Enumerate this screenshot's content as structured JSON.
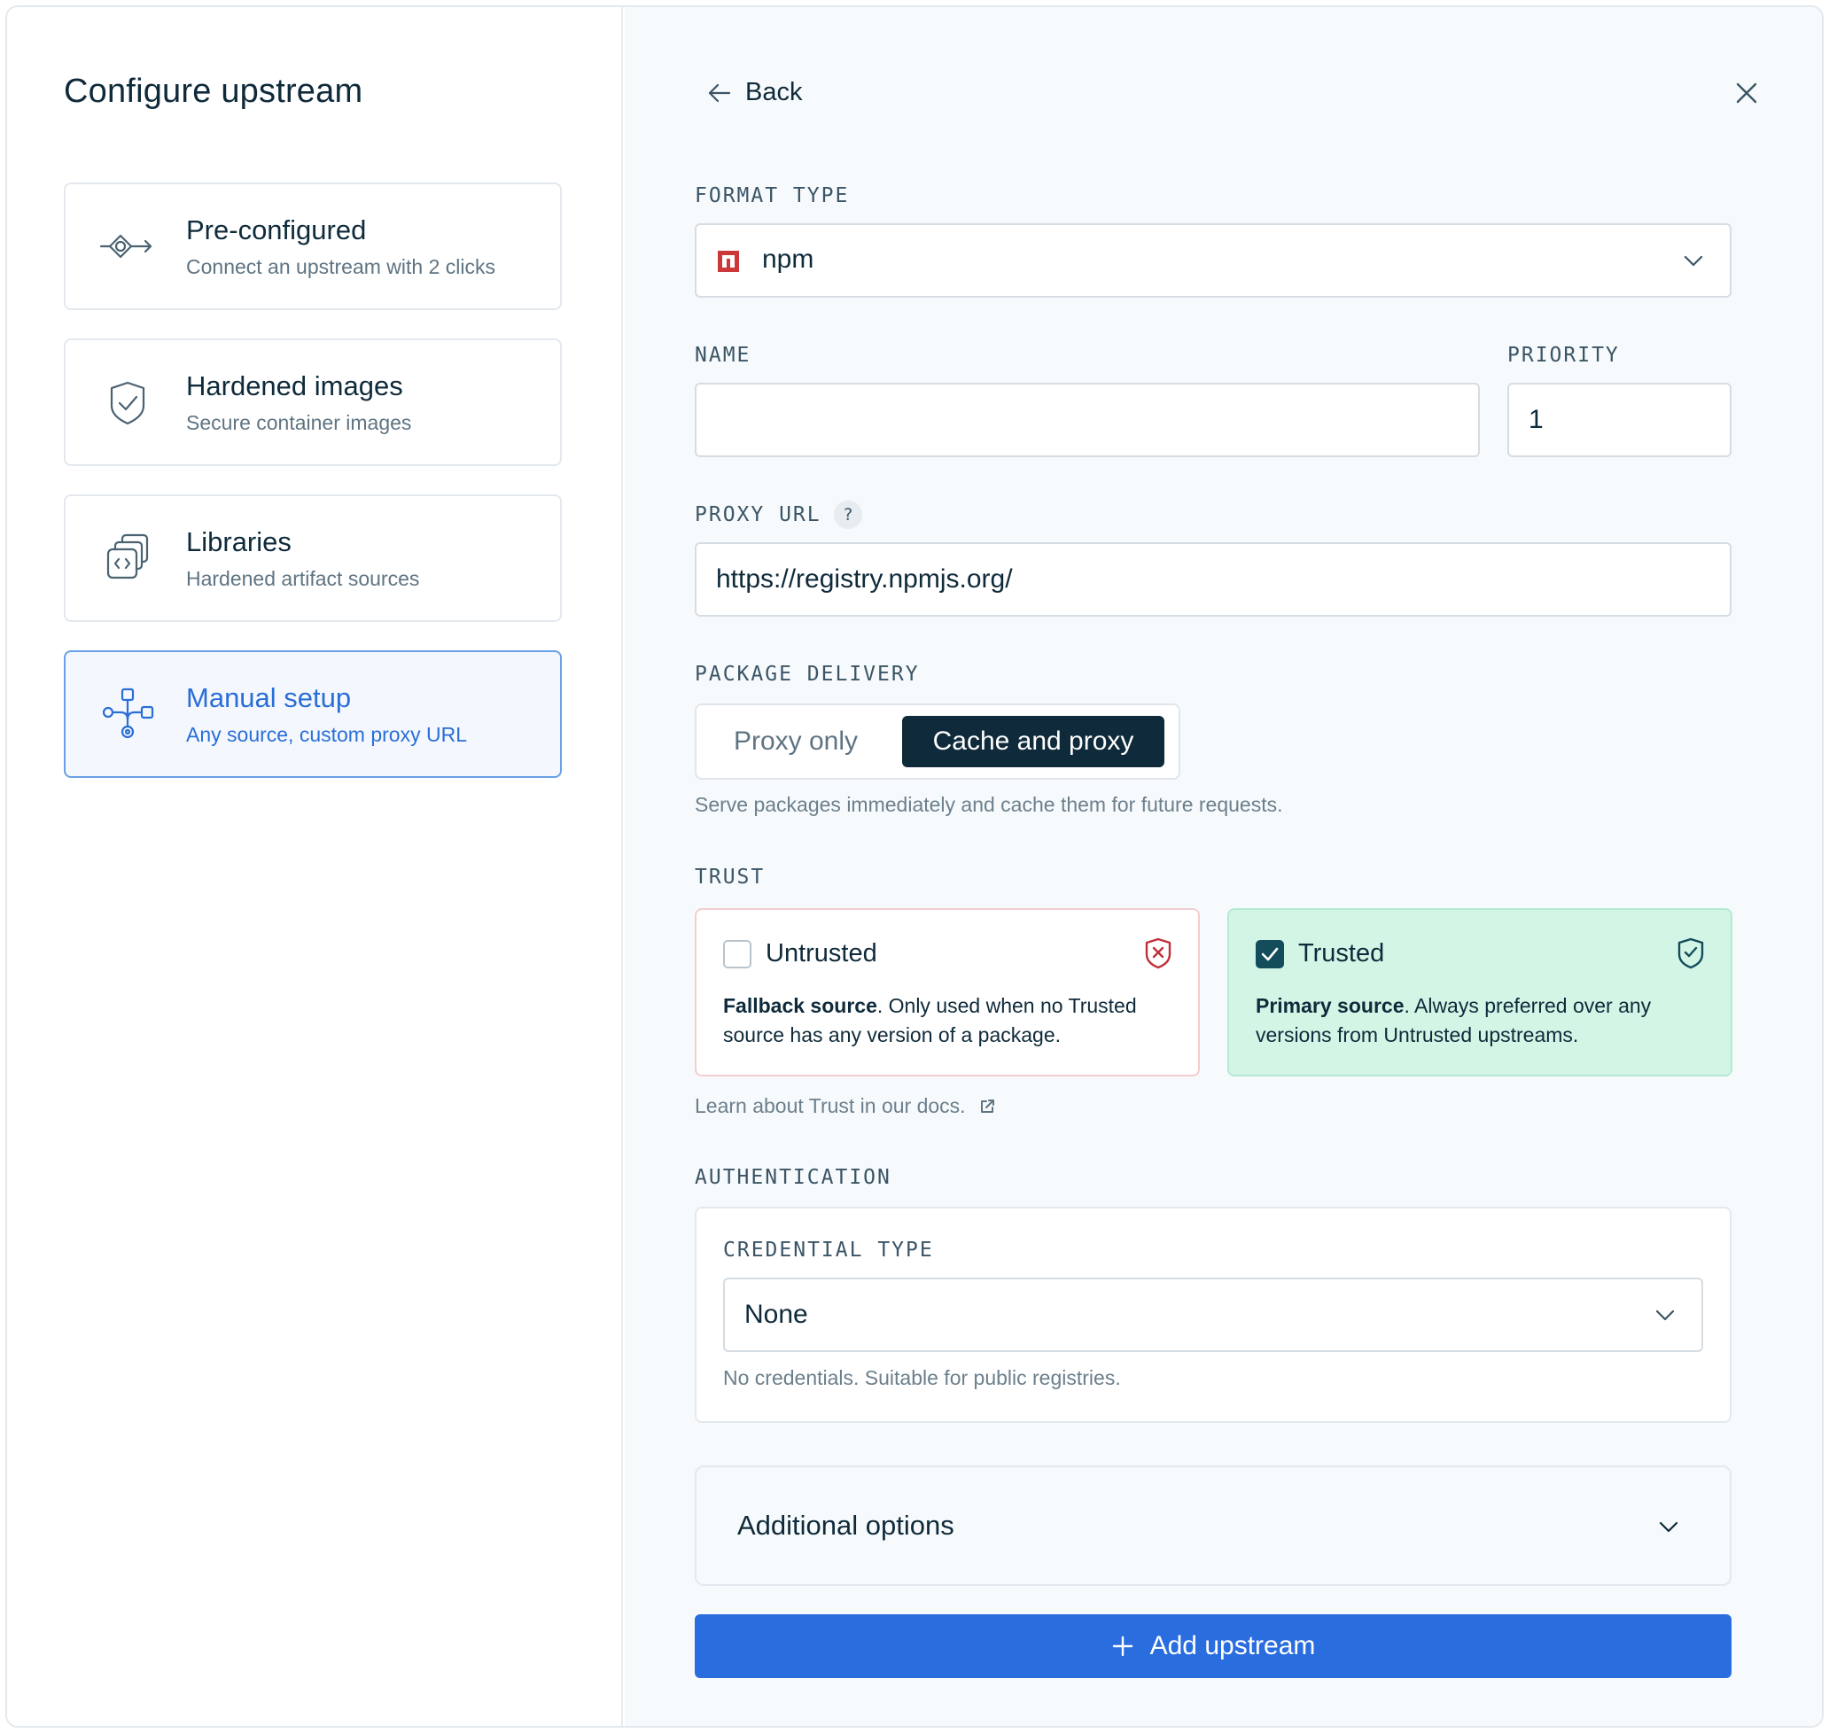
{
  "sidebar": {
    "title": "Configure upstream",
    "options": [
      {
        "title": "Pre-configured",
        "subtitle": "Connect an upstream with 2 clicks",
        "icon": "connector-icon"
      },
      {
        "title": "Hardened images",
        "subtitle": "Secure container images",
        "icon": "shield-check-icon"
      },
      {
        "title": "Libraries",
        "subtitle": "Hardened artifact sources",
        "icon": "code-stack-icon"
      },
      {
        "title": "Manual setup",
        "subtitle": "Any source, custom proxy URL",
        "icon": "network-nodes-icon",
        "selected": true
      }
    ]
  },
  "header": {
    "back_label": "Back"
  },
  "format": {
    "label": "FORMAT TYPE",
    "value": "npm",
    "icon": "npm-logo-icon"
  },
  "name": {
    "label": "NAME",
    "value": ""
  },
  "priority": {
    "label": "PRIORITY",
    "value": "1"
  },
  "proxy_url": {
    "label": "PROXY URL",
    "help_glyph": "?",
    "value": "https://registry.npmjs.org/"
  },
  "delivery": {
    "label": "PACKAGE DELIVERY",
    "options": [
      "Proxy only",
      "Cache and proxy"
    ],
    "selected": "Cache and proxy",
    "helper": "Serve packages immediately and cache them for future requests."
  },
  "trust": {
    "label": "TRUST",
    "untrusted": {
      "title": "Untrusted",
      "desc_bold": "Fallback source",
      "desc_rest": ". Only used when no Trusted source has any version of a package.",
      "checked": false
    },
    "trusted": {
      "title": "Trusted",
      "desc_bold": "Primary source",
      "desc_rest": ". Always preferred over any versions from Untrusted upstreams.",
      "checked": true
    },
    "docs_link": "Learn about Trust in our docs."
  },
  "auth": {
    "label": "AUTHENTICATION",
    "credential_label": "CREDENTIAL TYPE",
    "credential_value": "None",
    "helper": "No credentials. Suitable for public registries."
  },
  "additional": {
    "label": "Additional options"
  },
  "submit": {
    "label": "Add upstream"
  },
  "colors": {
    "accent": "#2a6ddf",
    "dark": "#0f2a3a",
    "trusted_bg": "#d3f5e5",
    "untrusted_border": "#f3cdd0",
    "npm_red": "#cb3837"
  }
}
